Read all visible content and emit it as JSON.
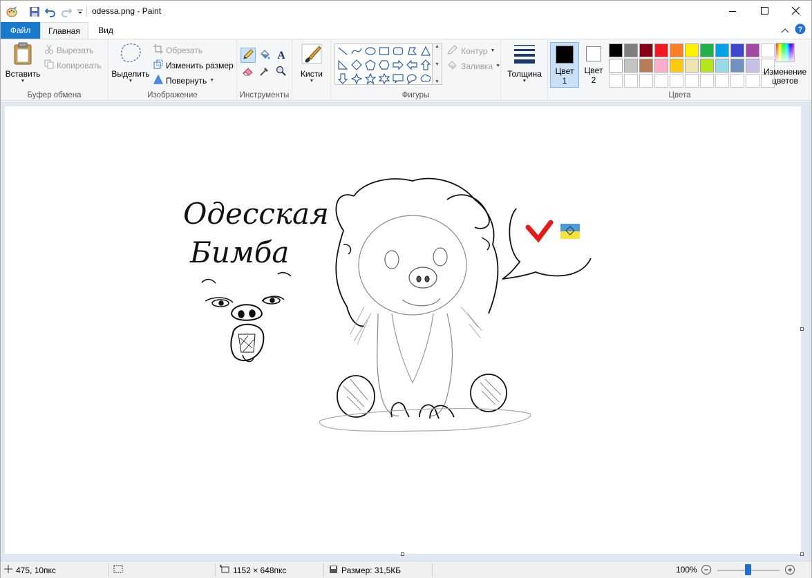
{
  "window": {
    "title": "odessa.png - Paint",
    "minimize_icon": "minimize-icon",
    "maximize_icon": "maximize-icon",
    "close_icon": "close-icon"
  },
  "tabs": {
    "file": "Файл",
    "home": "Главная",
    "view": "Вид"
  },
  "ribbon": {
    "clipboard": {
      "label": "Буфер обмена",
      "paste": "Вставить",
      "cut": "Вырезать",
      "copy": "Копировать"
    },
    "image": {
      "label": "Изображение",
      "select": "Выделить",
      "crop": "Обрезать",
      "resize": "Изменить размер",
      "rotate": "Повернуть"
    },
    "tools": {
      "label": "Инструменты",
      "selected": "pencil"
    },
    "brushes": {
      "label": "Кисти"
    },
    "shapes": {
      "label": "Фигуры",
      "outline": "Контур",
      "fill": "Заливка"
    },
    "size": {
      "label": "Толщина"
    },
    "colors": {
      "label": "Цвета",
      "color1_label": "Цвет",
      "color1_num": "1",
      "color2_label": "Цвет",
      "color2_num": "2",
      "color1": "#000000",
      "color2": "#ffffff",
      "edit_line1": "Изменение",
      "edit_line2": "цветов",
      "palette_row1": [
        "#000000",
        "#7f7f7f",
        "#880015",
        "#ed1c24",
        "#ff7f27",
        "#fff200",
        "#22b14c",
        "#00a2e8",
        "#3f48cc",
        "#a349a4"
      ],
      "palette_row2": [
        "#ffffff",
        "#c3c3c3",
        "#b97a57",
        "#ffaec9",
        "#ffc90e",
        "#efe4b0",
        "#b5e61d",
        "#99d9ea",
        "#7092be",
        "#c8bfe7"
      ]
    }
  },
  "canvas": {
    "text_line1": "Одесская",
    "text_line2": "Бимба"
  },
  "status": {
    "cursor_pos": "475, 10пкс",
    "image_size": "1152 × 648пкс",
    "file_size": "Размер: 31,5КБ",
    "zoom": "100%"
  }
}
